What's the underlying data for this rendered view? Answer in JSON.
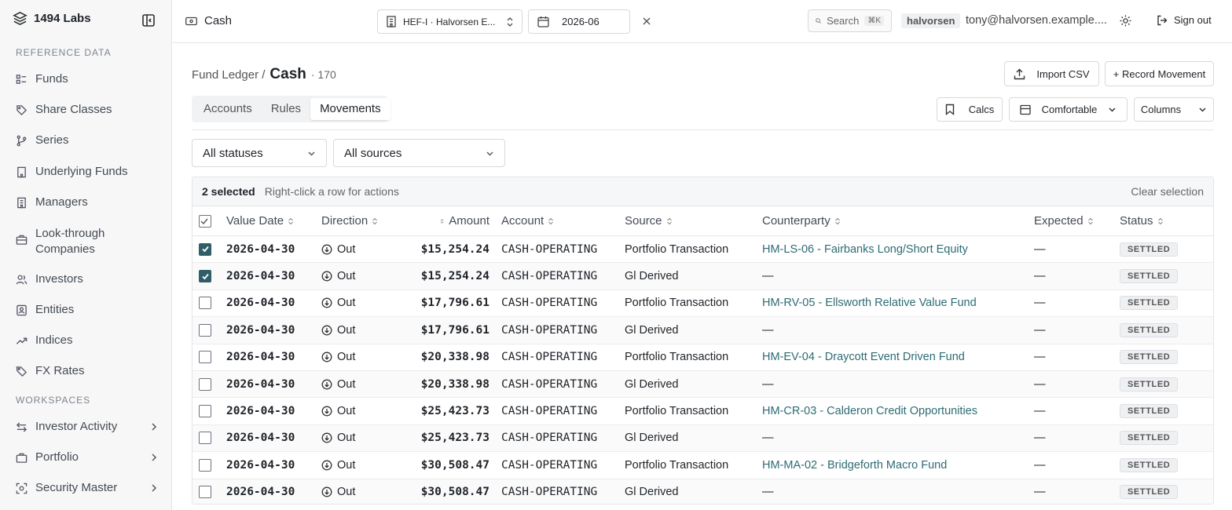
{
  "app": {
    "name": "1494 Labs"
  },
  "sidebar": {
    "sections": [
      {
        "label": "REFERENCE DATA"
      },
      {
        "label": "WORKSPACES"
      }
    ],
    "items": [
      {
        "label": "Funds",
        "icon": "list-icon"
      },
      {
        "label": "Share Classes",
        "icon": "tag-icon"
      },
      {
        "label": "Series",
        "icon": "branch-icon"
      },
      {
        "label": "Underlying Funds",
        "icon": "building-icon"
      },
      {
        "label": "Managers",
        "icon": "building-icon"
      },
      {
        "label": "Look-through Companies",
        "icon": "briefcase-icon"
      },
      {
        "label": "Investors",
        "icon": "users-icon"
      },
      {
        "label": "Entities",
        "icon": "id-card-icon"
      },
      {
        "label": "Indices",
        "icon": "trend-icon"
      },
      {
        "label": "FX Rates",
        "icon": "exchange-icon"
      }
    ],
    "workspaces": [
      {
        "label": "Investor Activity",
        "icon": "arrows-icon"
      },
      {
        "label": "Portfolio",
        "icon": "folder-icon"
      },
      {
        "label": "Security Master",
        "icon": "scan-icon"
      }
    ]
  },
  "topbar": {
    "page": "Cash",
    "fund_select": "HEF-I · Halvorsen E...",
    "period": "2026-06",
    "search_placeholder": "Search",
    "search_shortcut": "⌘K",
    "user_badge": "halvorsen",
    "email": "tony@halvorsen.example....",
    "sign_out": "Sign out"
  },
  "header": {
    "crumb_parent": "Fund Ledger /",
    "title": "Cash",
    "count": "· 170",
    "import_csv": "Import CSV",
    "record_movement": "+ Record Movement"
  },
  "tabs": [
    "Accounts",
    "Rules",
    "Movements"
  ],
  "active_tab": "Movements",
  "toolbar": {
    "calcs": "Calcs",
    "density": "Comfortable",
    "columns": "Columns"
  },
  "filters": {
    "status": "All statuses",
    "source": "All sources"
  },
  "selection": {
    "count_text": "2 selected",
    "hint": "Right-click a row for actions",
    "clear": "Clear selection"
  },
  "columns": [
    "Value Date",
    "Direction",
    "Amount",
    "Account",
    "Source",
    "Counterparty",
    "Expected",
    "Status"
  ],
  "rows": [
    {
      "checked": true,
      "date": "2026-04-30",
      "direction": "Out",
      "amount": "$15,254.24",
      "account": "CASH-OPERATING",
      "source": "Portfolio Transaction",
      "counterparty": "HM-LS-06 - Fairbanks Long/Short Equity",
      "cp_link": true,
      "expected": "—",
      "status": "SETTLED"
    },
    {
      "checked": true,
      "date": "2026-04-30",
      "direction": "Out",
      "amount": "$15,254.24",
      "account": "CASH-OPERATING",
      "source": "Gl Derived",
      "counterparty": "—",
      "cp_link": false,
      "expected": "—",
      "status": "SETTLED"
    },
    {
      "checked": false,
      "date": "2026-04-30",
      "direction": "Out",
      "amount": "$17,796.61",
      "account": "CASH-OPERATING",
      "source": "Portfolio Transaction",
      "counterparty": "HM-RV-05 - Ellsworth Relative Value Fund",
      "cp_link": true,
      "expected": "—",
      "status": "SETTLED"
    },
    {
      "checked": false,
      "date": "2026-04-30",
      "direction": "Out",
      "amount": "$17,796.61",
      "account": "CASH-OPERATING",
      "source": "Gl Derived",
      "counterparty": "—",
      "cp_link": false,
      "expected": "—",
      "status": "SETTLED"
    },
    {
      "checked": false,
      "date": "2026-04-30",
      "direction": "Out",
      "amount": "$20,338.98",
      "account": "CASH-OPERATING",
      "source": "Portfolio Transaction",
      "counterparty": "HM-EV-04 - Draycott Event Driven Fund",
      "cp_link": true,
      "expected": "—",
      "status": "SETTLED"
    },
    {
      "checked": false,
      "date": "2026-04-30",
      "direction": "Out",
      "amount": "$20,338.98",
      "account": "CASH-OPERATING",
      "source": "Gl Derived",
      "counterparty": "—",
      "cp_link": false,
      "expected": "—",
      "status": "SETTLED"
    },
    {
      "checked": false,
      "date": "2026-04-30",
      "direction": "Out",
      "amount": "$25,423.73",
      "account": "CASH-OPERATING",
      "source": "Portfolio Transaction",
      "counterparty": "HM-CR-03 - Calderon Credit Opportunities",
      "cp_link": true,
      "expected": "—",
      "status": "SETTLED"
    },
    {
      "checked": false,
      "date": "2026-04-30",
      "direction": "Out",
      "amount": "$25,423.73",
      "account": "CASH-OPERATING",
      "source": "Gl Derived",
      "counterparty": "—",
      "cp_link": false,
      "expected": "—",
      "status": "SETTLED"
    },
    {
      "checked": false,
      "date": "2026-04-30",
      "direction": "Out",
      "amount": "$30,508.47",
      "account": "CASH-OPERATING",
      "source": "Portfolio Transaction",
      "counterparty": "HM-MA-02 - Bridgeforth Macro Fund",
      "cp_link": true,
      "expected": "—",
      "status": "SETTLED"
    },
    {
      "checked": false,
      "date": "2026-04-30",
      "direction": "Out",
      "amount": "$30,508.47",
      "account": "CASH-OPERATING",
      "source": "Gl Derived",
      "counterparty": "—",
      "cp_link": false,
      "expected": "—",
      "status": "SETTLED"
    }
  ],
  "colors": {
    "accent": "#2f5e68",
    "link": "#2e6b73"
  }
}
